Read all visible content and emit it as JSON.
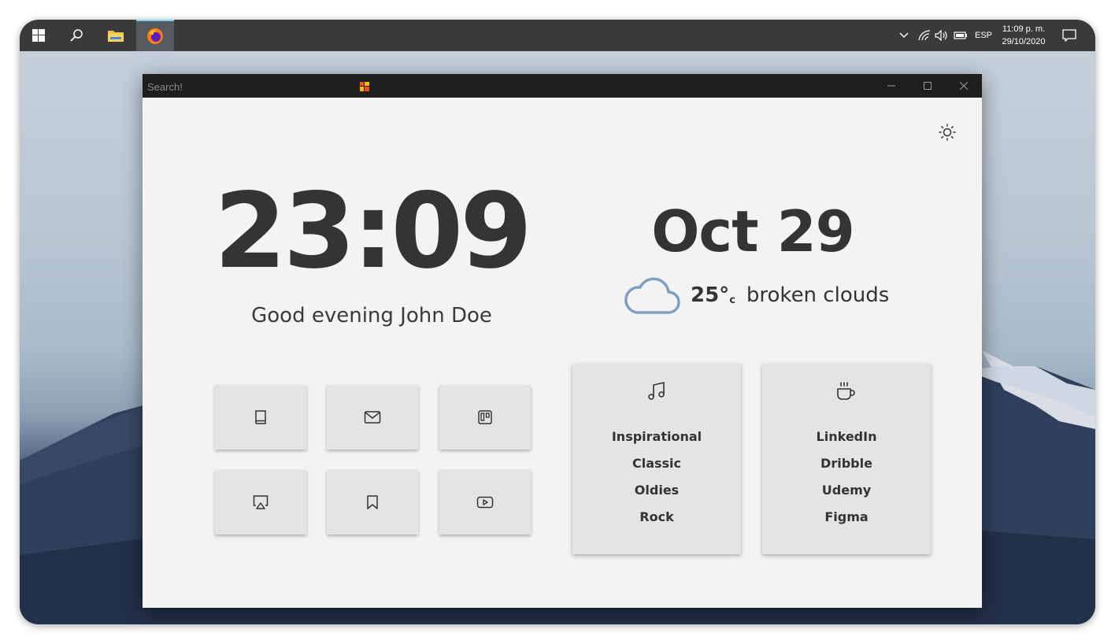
{
  "taskbar": {
    "icons": [
      "windows-start-icon",
      "search-icon",
      "file-explorer-icon",
      "firefox-icon"
    ],
    "tray_icons": [
      "chevron-up-icon",
      "wifi-icon",
      "volume-icon",
      "battery-icon",
      "notifications-icon"
    ],
    "language": "ESP",
    "time": "11:09 p. m.",
    "date": "29/10/2020"
  },
  "browser": {
    "search_placeholder": "Search!",
    "controls": [
      "minimize-icon",
      "maximize-icon",
      "close-icon"
    ]
  },
  "page": {
    "time": "23:09",
    "greeting": "Good evening John Doe",
    "date": "Oct 29",
    "weather": {
      "icon": "cloud-icon",
      "temperature": "25°",
      "unit": "c",
      "description": "broken clouds",
      "icon_color": "#7f9fbf"
    },
    "shortcuts": [
      {
        "icon": "book-icon",
        "name": "shortcut-book"
      },
      {
        "icon": "mail-icon",
        "name": "shortcut-mail"
      },
      {
        "icon": "trello-icon",
        "name": "shortcut-trello"
      },
      {
        "icon": "airplay-icon",
        "name": "shortcut-airplay"
      },
      {
        "icon": "bookmark-icon",
        "name": "shortcut-bookmark"
      },
      {
        "icon": "youtube-icon",
        "name": "shortcut-youtube"
      }
    ],
    "music_card": {
      "icon": "music-icon",
      "links": [
        "Inspirational",
        "Classic",
        "Oldies",
        "Rock"
      ]
    },
    "coffee_card": {
      "icon": "coffee-icon",
      "links": [
        "LinkedIn",
        "Dribble",
        "Udemy",
        "Figma"
      ]
    }
  },
  "colors": {
    "taskbar": "#3a3a3a",
    "titlebar": "#1e1e1e",
    "background": "#f3f3f3",
    "tile": "#e4e4e4",
    "text": "#343434",
    "accent": "#7ad0f0"
  }
}
